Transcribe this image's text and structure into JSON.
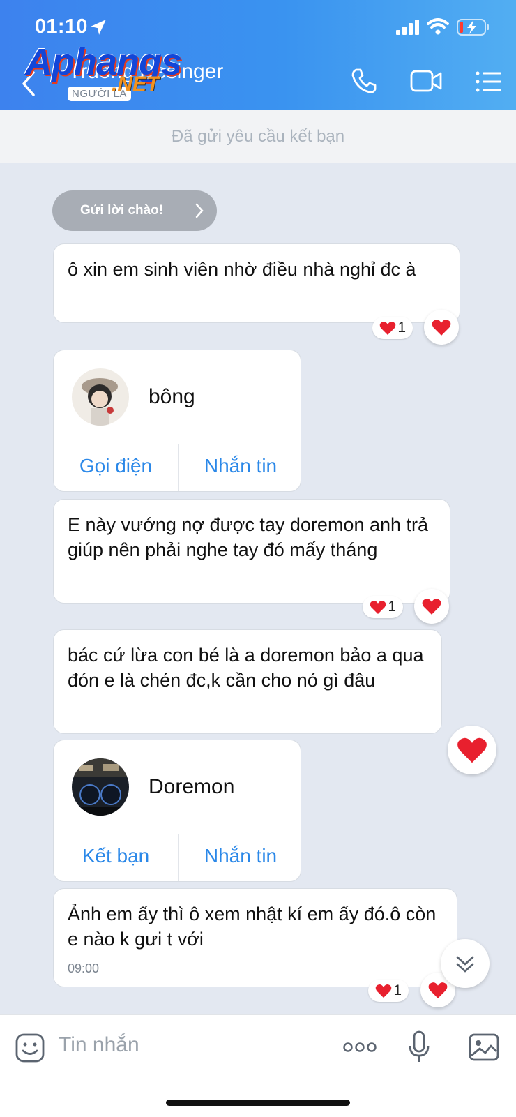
{
  "status_bar": {
    "time": "01:10"
  },
  "header": {
    "contact_name": "Truong Desinger",
    "badge": "NGƯỜI LẠ",
    "watermark_main": "Aphangs",
    "watermark_sub": ".NET"
  },
  "friend_request": {
    "text": "Đã gửi yêu cầu kết bạn"
  },
  "greeting": {
    "label": "Gửi lời chào!"
  },
  "messages": [
    {
      "text": "ô xin em sinh viên nhờ điều nhà nghỉ đc à",
      "reaction_count": "1"
    },
    {
      "text": "E này vướng nợ được tay doremon anh trả giúp nên phải nghe tay đó mấy tháng",
      "reaction_count": "1"
    },
    {
      "text": "bác cứ lừa con bé là a doremon bảo a qua đón e là chén đc,k cần cho nó gì đâu"
    },
    {
      "text": "Ảnh em ấy thì ô xem nhật kí em ấy đó.ô còn e nào k gưi t với",
      "time": "09:00",
      "reaction_count": "1"
    }
  ],
  "cards": [
    {
      "name": "bông",
      "action_left": "Gọi điện",
      "action_right": "Nhắn tin"
    },
    {
      "name": "Doremon",
      "action_left": "Kết bạn",
      "action_right": "Nhắn tin"
    }
  ],
  "input": {
    "placeholder": "Tin nhắn"
  },
  "colors": {
    "header": "#3d82ee",
    "accent": "#2b88e8",
    "heart": "#e8202e",
    "background": "#e3e8f1"
  }
}
